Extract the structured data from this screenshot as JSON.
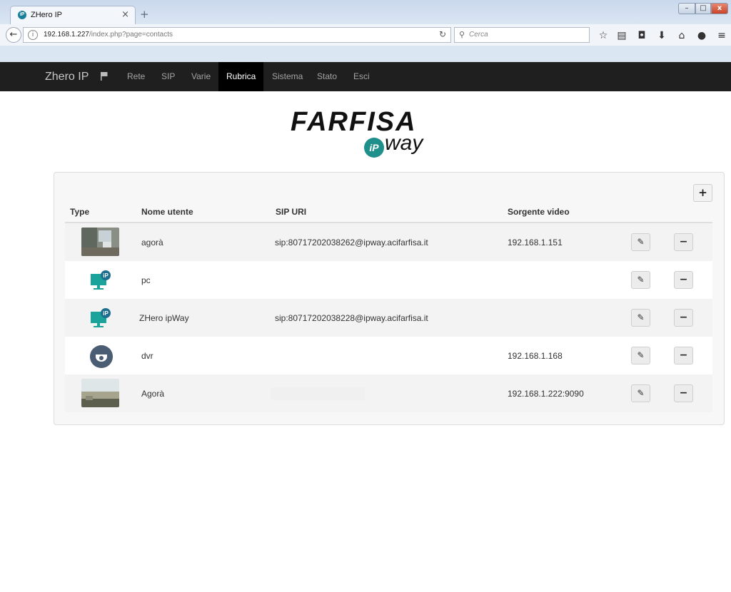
{
  "browser": {
    "tab_title": "ZHero IP",
    "tab_favicon": "iP",
    "tab_close": "×",
    "new_tab": "+",
    "url_host": "192.168.1.227",
    "url_path": "/index.php?page=contacts",
    "search_placeholder": "Cerca",
    "window_controls": {
      "minimize": "–",
      "maximize": "□",
      "close": "x"
    }
  },
  "nav": {
    "brand": "Zhero IP",
    "items": [
      {
        "label": "Rete"
      },
      {
        "label": "SIP"
      },
      {
        "label": "Varie"
      },
      {
        "label": "Rubrica",
        "active": true
      },
      {
        "label": "Sistema"
      },
      {
        "label": "Stato"
      },
      {
        "label": "Esci"
      }
    ]
  },
  "logo": {
    "word": "FARFISA",
    "ip": "iP",
    "way": "way"
  },
  "table": {
    "add_label": "+",
    "headers": {
      "type": "Type",
      "name": "Nome utente",
      "sip": "SIP URI",
      "video": "Sorgente video"
    },
    "edit_glyph": "✎",
    "delete_glyph": "−",
    "rows": [
      {
        "type": "camera-photo",
        "name": "agorà",
        "sip": "sip:80717202038262@ipway.acifarfisa.it",
        "video": "192.168.1.151"
      },
      {
        "type": "pc",
        "name": "pc",
        "sip": "",
        "video": ""
      },
      {
        "type": "pc",
        "name": "ZHero ipWay",
        "sip": "sip:80717202038228@ipway.acifarfisa.it",
        "video": ""
      },
      {
        "type": "dvr",
        "name": "dvr",
        "sip": "",
        "video": "192.168.1.168"
      },
      {
        "type": "camera-photo",
        "name": "Agorà",
        "sip": "",
        "video": "192.168.1.222:9090"
      }
    ]
  },
  "colors": {
    "navbar": "#1f1f1f",
    "active_nav": "#000000",
    "brand_teal": "#1e8f8a"
  }
}
